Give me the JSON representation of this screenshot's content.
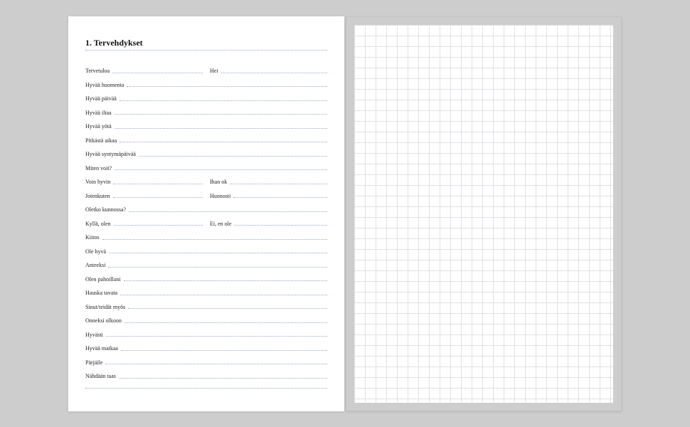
{
  "heading": "1. Tervehdykset",
  "rows": [
    {
      "cols": [
        "Tervetuloa",
        "Hei"
      ]
    },
    {
      "cols": [
        "Hyvää huomenta"
      ]
    },
    {
      "cols": [
        "Hyvää päivää"
      ]
    },
    {
      "cols": [
        "Hyvää iltaa"
      ]
    },
    {
      "cols": [
        "Hyvää yötä"
      ]
    },
    {
      "cols": [
        "Pitkästä aikaa"
      ]
    },
    {
      "cols": [
        "Hyvää syntymäpäivää"
      ]
    },
    {
      "cols": [
        "Miten voit?"
      ]
    },
    {
      "cols": [
        "Voin hyvin",
        "Ihan ok"
      ]
    },
    {
      "cols": [
        "Jotenkuten",
        "Huonosti"
      ]
    },
    {
      "cols": [
        "Oletko kunnossa?"
      ]
    },
    {
      "cols": [
        "Kyllä, olen",
        "Ei, en ole"
      ]
    },
    {
      "cols": [
        "Kiitos"
      ]
    },
    {
      "cols": [
        "Ole hyvä"
      ]
    },
    {
      "cols": [
        "Anteeksi"
      ]
    },
    {
      "cols": [
        "Olen pahoillani"
      ]
    },
    {
      "cols": [
        "Hauska tavata"
      ]
    },
    {
      "cols": [
        "Sinut/teidät myös"
      ]
    },
    {
      "cols": [
        "Onneksi olkoon"
      ]
    },
    {
      "cols": [
        "Hyvästi"
      ]
    },
    {
      "cols": [
        "Hyvää matkaa"
      ]
    },
    {
      "cols": [
        "Pärjäile"
      ]
    },
    {
      "cols": [
        "Nähdään taas"
      ]
    }
  ]
}
